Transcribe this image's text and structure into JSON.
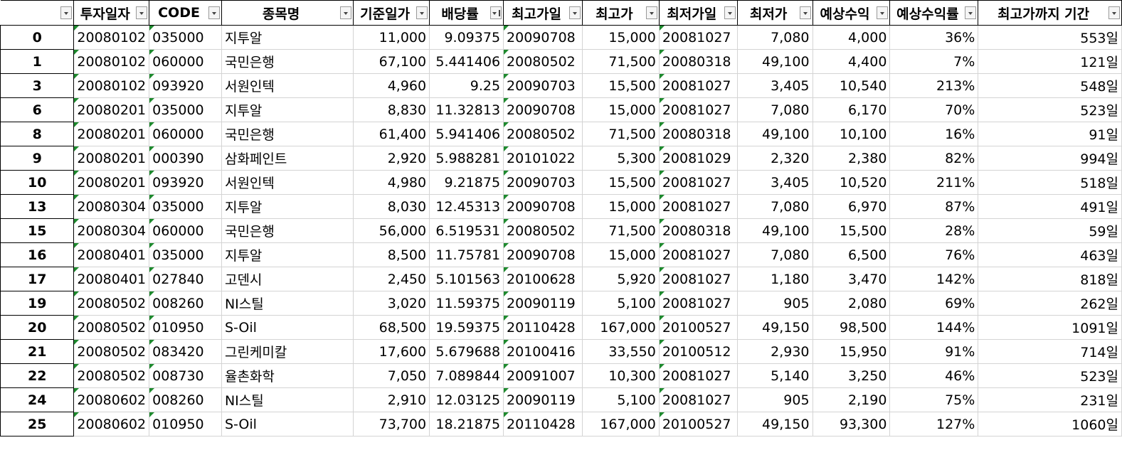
{
  "headers": [
    {
      "label": "",
      "name": "index"
    },
    {
      "label": "투자일자",
      "name": "invest-date"
    },
    {
      "label": "CODE",
      "name": "code"
    },
    {
      "label": "종목명",
      "name": "stock-name"
    },
    {
      "label": "기준일가",
      "name": "base-price"
    },
    {
      "label": "배당률",
      "name": "dividend-rate"
    },
    {
      "label": "최고가일",
      "name": "high-date"
    },
    {
      "label": "최고가",
      "name": "high-price"
    },
    {
      "label": "최저가일",
      "name": "low-date"
    },
    {
      "label": "최저가",
      "name": "low-price"
    },
    {
      "label": "예상수익",
      "name": "expected-profit"
    },
    {
      "label": "예상수익률",
      "name": "expected-return"
    },
    {
      "label": "최고가까지 기간",
      "name": "days-to-high"
    }
  ],
  "active_filter_column": "dividend-rate",
  "rows": [
    [
      "0",
      "20080102",
      "035000",
      "지투알",
      "11,000",
      "9.09375",
      "20090708",
      "15,000",
      "20081027",
      "7,080",
      "4,000",
      "36%",
      "553일"
    ],
    [
      "1",
      "20080102",
      "060000",
      "국민은행",
      "67,100",
      "5.441406",
      "20080502",
      "71,500",
      "20080318",
      "49,100",
      "4,400",
      "7%",
      "121일"
    ],
    [
      "3",
      "20080102",
      "093920",
      "서원인텍",
      "4,960",
      "9.25",
      "20090703",
      "15,500",
      "20081027",
      "3,405",
      "10,540",
      "213%",
      "548일"
    ],
    [
      "6",
      "20080201",
      "035000",
      "지투알",
      "8,830",
      "11.32813",
      "20090708",
      "15,000",
      "20081027",
      "7,080",
      "6,170",
      "70%",
      "523일"
    ],
    [
      "8",
      "20080201",
      "060000",
      "국민은행",
      "61,400",
      "5.941406",
      "20080502",
      "71,500",
      "20080318",
      "49,100",
      "10,100",
      "16%",
      "91일"
    ],
    [
      "9",
      "20080201",
      "000390",
      "삼화페인트",
      "2,920",
      "5.988281",
      "20101022",
      "5,300",
      "20081029",
      "2,320",
      "2,380",
      "82%",
      "994일"
    ],
    [
      "10",
      "20080201",
      "093920",
      "서원인텍",
      "4,980",
      "9.21875",
      "20090703",
      "15,500",
      "20081027",
      "3,405",
      "10,520",
      "211%",
      "518일"
    ],
    [
      "13",
      "20080304",
      "035000",
      "지투알",
      "8,030",
      "12.45313",
      "20090708",
      "15,000",
      "20081027",
      "7,080",
      "6,970",
      "87%",
      "491일"
    ],
    [
      "15",
      "20080304",
      "060000",
      "국민은행",
      "56,000",
      "6.519531",
      "20080502",
      "71,500",
      "20080318",
      "49,100",
      "15,500",
      "28%",
      "59일"
    ],
    [
      "16",
      "20080401",
      "035000",
      "지투알",
      "8,500",
      "11.75781",
      "20090708",
      "15,000",
      "20081027",
      "7,080",
      "6,500",
      "76%",
      "463일"
    ],
    [
      "17",
      "20080401",
      "027840",
      "고덴시",
      "2,450",
      "5.101563",
      "20100628",
      "5,920",
      "20081027",
      "1,180",
      "3,470",
      "142%",
      "818일"
    ],
    [
      "19",
      "20080502",
      "008260",
      "NI스틸",
      "3,020",
      "11.59375",
      "20090119",
      "5,100",
      "20081027",
      "905",
      "2,080",
      "69%",
      "262일"
    ],
    [
      "20",
      "20080502",
      "010950",
      "S-Oil",
      "68,500",
      "19.59375",
      "20110428",
      "167,000",
      "20100527",
      "49,150",
      "98,500",
      "144%",
      "1091일"
    ],
    [
      "21",
      "20080502",
      "083420",
      "그린케미칼",
      "17,600",
      "5.679688",
      "20100416",
      "33,550",
      "20100512",
      "2,930",
      "15,950",
      "91%",
      "714일"
    ],
    [
      "22",
      "20080502",
      "008730",
      "율촌화학",
      "7,050",
      "7.089844",
      "20091007",
      "10,300",
      "20081027",
      "5,140",
      "3,250",
      "46%",
      "523일"
    ],
    [
      "24",
      "20080602",
      "008260",
      "NI스틸",
      "2,910",
      "12.03125",
      "20090119",
      "5,100",
      "20081027",
      "905",
      "2,190",
      "75%",
      "231일"
    ],
    [
      "25",
      "20080602",
      "010950",
      "S-Oil",
      "73,700",
      "18.21875",
      "20110428",
      "167,000",
      "20100527",
      "49,150",
      "93,300",
      "127%",
      "1060일"
    ]
  ],
  "colors": {
    "grid_line": "#d4d4d4",
    "header_border": "#000000",
    "text_flag": "#1e8a2e"
  }
}
